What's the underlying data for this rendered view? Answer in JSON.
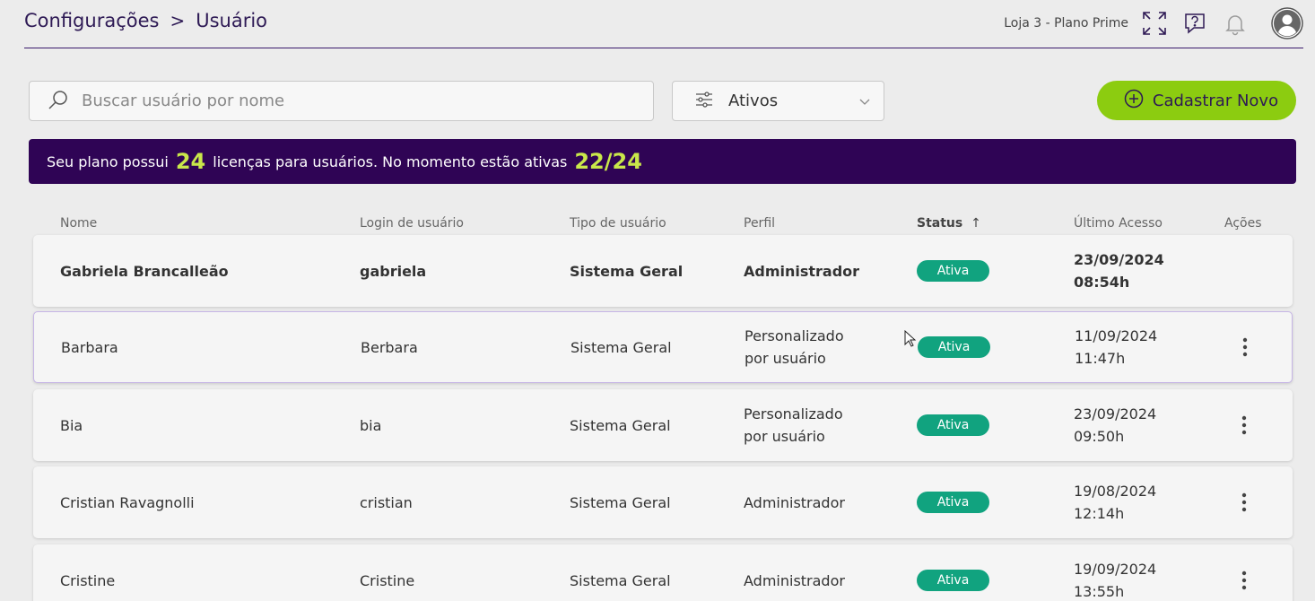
{
  "breadcrumb": {
    "section": "Configurações",
    "separator": ">",
    "current": "Usuário"
  },
  "header": {
    "plan_text": "Loja 3 - Plano Prime",
    "icons": [
      "expand-icon",
      "help-icon",
      "bell-icon",
      "avatar-icon"
    ]
  },
  "search": {
    "placeholder": "Buscar usuário por nome",
    "value": ""
  },
  "filter": {
    "selected": "Ativos"
  },
  "new_button": {
    "label": "Cadastrar Novo"
  },
  "banner": {
    "text_before": "Seu plano possui",
    "licenses": "24",
    "text_middle": "licenças para usuários. No momento estão ativas",
    "active": "22/24"
  },
  "table": {
    "columns": {
      "nome": "Nome",
      "login": "Login de usuário",
      "tipo": "Tipo de usuário",
      "perfil": "Perfil",
      "status": "Status",
      "acesso": "Último Acesso",
      "acoes": "Ações"
    },
    "sort_indicator": "↑",
    "rows": [
      {
        "nome": "Gabriela Brancalleão",
        "login": "gabriela",
        "tipo": "Sistema Geral",
        "perfil": "Administrador",
        "status": "Ativa",
        "data": "23/09/2024",
        "hora": "08:54h"
      },
      {
        "nome": "Barbara",
        "login": "Berbara",
        "tipo": "Sistema Geral",
        "perfil": "Personalizado por usuário",
        "status": "Ativa",
        "data": "11/09/2024",
        "hora": "11:47h"
      },
      {
        "nome": "Bia",
        "login": "bia",
        "tipo": "Sistema Geral",
        "perfil": "Personalizado por usuário",
        "status": "Ativa",
        "data": "23/09/2024",
        "hora": "09:50h"
      },
      {
        "nome": "Cristian Ravagnolli",
        "login": "cristian",
        "tipo": "Sistema Geral",
        "perfil": "Administrador",
        "status": "Ativa",
        "data": "19/08/2024",
        "hora": "12:14h"
      },
      {
        "nome": "Cristine",
        "login": "Cristine",
        "tipo": "Sistema Geral",
        "perfil": "Administrador",
        "status": "Ativa",
        "data": "19/09/2024",
        "hora": "13:55h"
      }
    ]
  },
  "colors": {
    "brand": "#2f0455",
    "accent": "#8ccc10",
    "highlight": "#c9e84a",
    "status_active": "#11a37f"
  }
}
